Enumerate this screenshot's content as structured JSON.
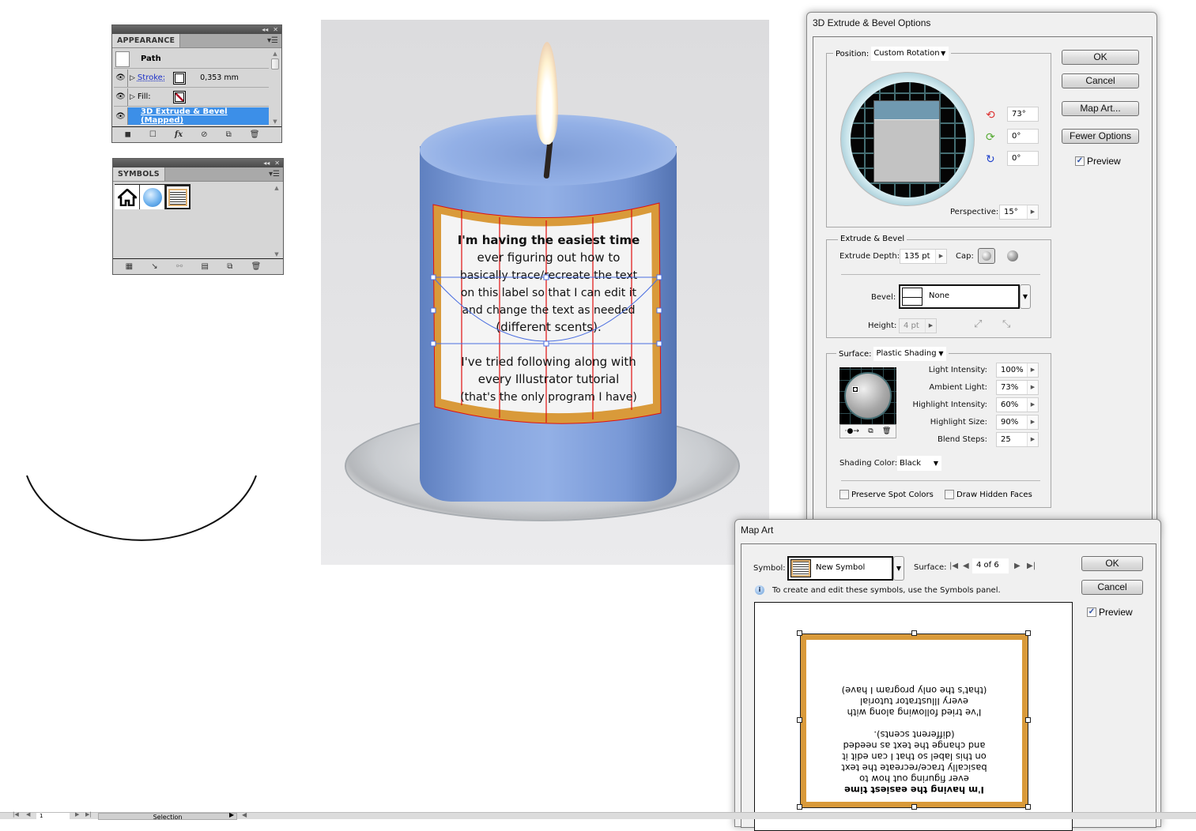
{
  "appearance_panel": {
    "tab_label": "APPEARANCE",
    "target_label": "Path",
    "rows": [
      {
        "label": "Stroke:",
        "value": "0,353 mm",
        "swatch": "white"
      },
      {
        "label": "Fill:",
        "value": "",
        "swatch": "none"
      },
      {
        "label": "3D Extrude & Bevel (Mapped)",
        "selected": true
      }
    ],
    "footer_icons": [
      "add-new-stroke-icon",
      "add-new-fill-icon",
      "fx-icon",
      "clear-appearance-icon",
      "duplicate-item-icon",
      "delete-item-icon"
    ],
    "fx_label": "fx"
  },
  "symbols_panel": {
    "tab_label": "SYMBOLS",
    "symbols": [
      "home-symbol",
      "globe-symbol",
      "label-symbol"
    ]
  },
  "canvas": {
    "label_text": {
      "line1": "I'm having the easiest time",
      "lines": [
        "ever figuring out how to",
        "basically trace/recreate the text",
        "on this label so that I can edit it",
        "and change the text as needed",
        "(different scents)."
      ],
      "lines2": [
        "I've tried following along with",
        "every Illustrator tutorial",
        "(that's the only program I have)"
      ]
    },
    "colors": {
      "candle": "#7b9bd8",
      "label_border": "#d99a3a",
      "mesh_lines": "#e01010",
      "selection": "#4a6ee0"
    }
  },
  "extrude_dialog": {
    "title": "3D Extrude & Bevel Options",
    "position_label": "Position:",
    "position_value": "Custom Rotation",
    "rotation": {
      "x": "73°",
      "y": "0°",
      "z": "0°"
    },
    "perspective_label": "Perspective:",
    "perspective_value": "15°",
    "buttons": {
      "ok": "OK",
      "cancel": "Cancel",
      "map_art": "Map Art...",
      "fewer_options": "Fewer Options"
    },
    "preview_label": "Preview",
    "preview_checked": true,
    "extrude_bevel": {
      "legend": "Extrude & Bevel",
      "depth_label": "Extrude Depth:",
      "depth_value": "135 pt",
      "cap_label": "Cap:",
      "bevel_label": "Bevel:",
      "bevel_value": "None",
      "height_label": "Height:",
      "height_value": "4 pt"
    },
    "surface": {
      "label": "Surface:",
      "value": "Plastic Shading",
      "light_intensity_label": "Light Intensity:",
      "light_intensity": "100%",
      "ambient_light_label": "Ambient Light:",
      "ambient_light": "73%",
      "highlight_intensity_label": "Highlight Intensity:",
      "highlight_intensity": "60%",
      "highlight_size_label": "Highlight Size:",
      "highlight_size": "90%",
      "blend_steps_label": "Blend Steps:",
      "blend_steps": "25",
      "shading_color_label": "Shading Color:",
      "shading_color": "Black",
      "preserve_spot_label": "Preserve Spot Colors",
      "preserve_spot_checked": false,
      "draw_hidden_label": "Draw Hidden Faces",
      "draw_hidden_checked": false
    }
  },
  "map_art_dialog": {
    "title": "Map Art",
    "symbol_label": "Symbol:",
    "symbol_value": "New Symbol",
    "surface_label": "Surface:",
    "surface_value": "4 of 6",
    "info_text": "To create and edit these symbols, use the Symbols panel.",
    "buttons": {
      "ok": "OK",
      "cancel": "Cancel"
    },
    "preview_label": "Preview",
    "preview_checked": true
  },
  "status_bar": {
    "page_value": "1",
    "tool_label": "Selection"
  }
}
